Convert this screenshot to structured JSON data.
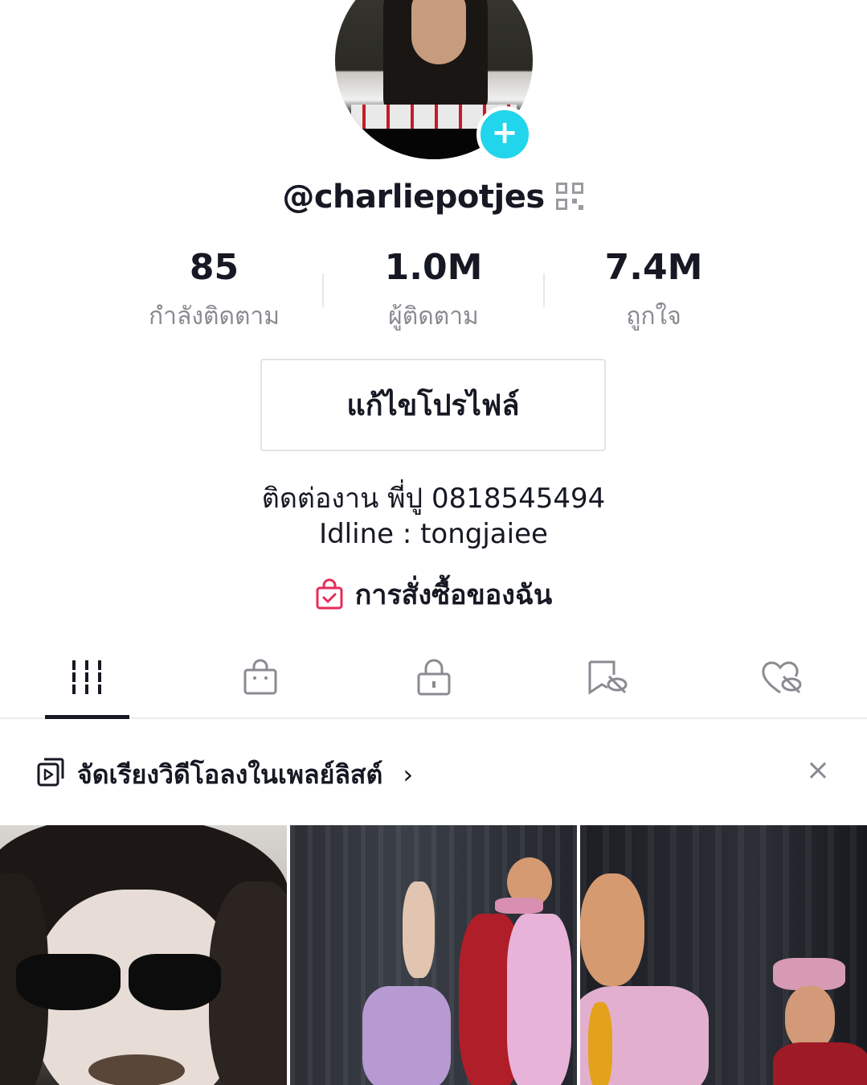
{
  "profile": {
    "username": "@charliepotjes",
    "edit_label": "แก้ไขโปรไฟล์",
    "bio_line1": "ติดต่องาน พี่ปู 0818545494",
    "bio_line2": "Idline : tongjaiee",
    "orders_label": "การสั่งซื้อของฉัน"
  },
  "stats": [
    {
      "value": "85",
      "label": "กำลังติดตาม"
    },
    {
      "value": "1.0M",
      "label": "ผู้ติดตาม"
    },
    {
      "value": "7.4M",
      "label": "ถูกใจ"
    }
  ],
  "tabs": [
    {
      "icon": "grid-icon",
      "active": true
    },
    {
      "icon": "shop-bag-icon",
      "active": false
    },
    {
      "icon": "lock-icon",
      "active": false
    },
    {
      "icon": "bookmark-hidden-icon",
      "active": false
    },
    {
      "icon": "heart-hidden-icon",
      "active": false
    }
  ],
  "playlist": {
    "text": "จัดเรียงวิดีโอลงในเพลย์ลิสต์",
    "chevron": "›",
    "close": "×"
  },
  "colors": {
    "accent": "#20d5ec",
    "orders_icon": "#e62c5a",
    "text_primary": "#161823",
    "text_secondary": "#8a8b91"
  }
}
